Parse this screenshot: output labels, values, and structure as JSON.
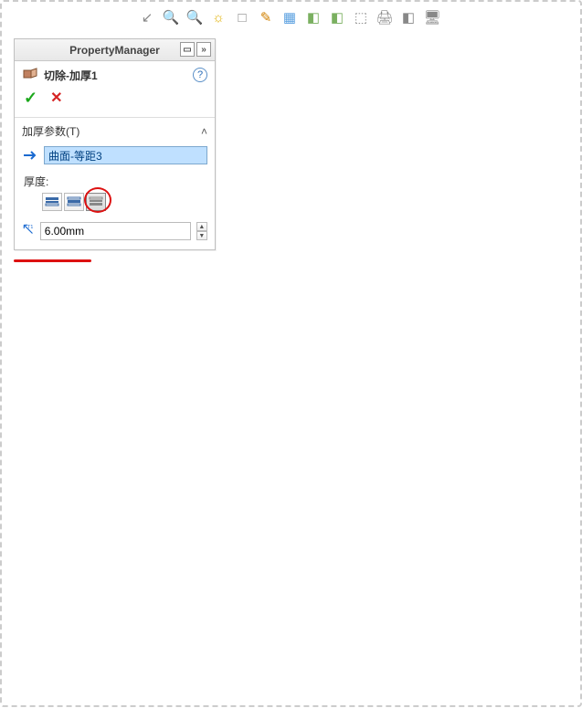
{
  "toolbar_icons": [
    "↙",
    "🔍",
    "🔍",
    "☼",
    "□",
    "✎",
    "▦",
    "◧",
    "◧",
    "⬚",
    "🖨",
    "◧",
    "🖥"
  ],
  "panel": {
    "title": "PropertyManager",
    "feature_name": "切除-加厚1",
    "help_symbol": "?",
    "ok_symbol": "✓",
    "cancel_symbol": "✕",
    "section_title": "加厚参数(T)",
    "selected_surface": "曲面-等距3",
    "thickness_label": "厚度:",
    "thickness_value": "6.00mm",
    "direction_selected_index": 2
  },
  "colors": {
    "panel_border": "#c0c0c0",
    "selection_bg": "#bfe0ff",
    "annotation": "#d11",
    "model_surface": "#4b6aa3"
  }
}
